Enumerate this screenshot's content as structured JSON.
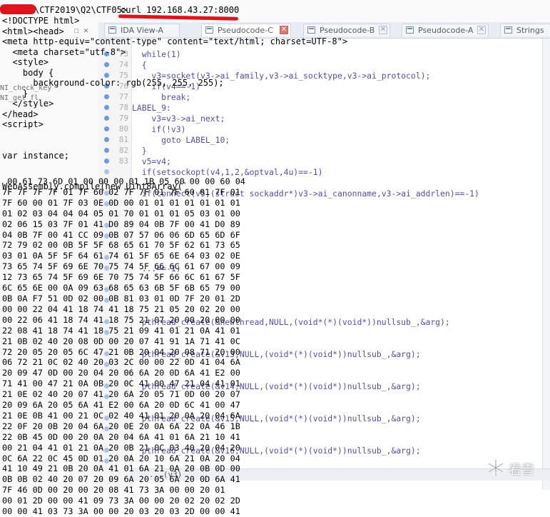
{
  "terminal": {
    "prompt": "\\CTF2019\\Q2\\CTF05>",
    "command": "curl 192.168.43.27:8000",
    "html_lines": [
      "<!DOCTYPE html>",
      "<html><head>",
      "<meta http-equiv=\"content-type\" content=\"text/html; charset=UTF-8\">",
      "  <meta charset=\"utf-8\">",
      "  <style>",
      "    body {",
      "      background-color: rgb(255, 255, 255);",
      "    }",
      "  </style>",
      "</head>",
      "<script>",
      "",
      "",
      "var instance;",
      "",
      "",
      "WebAssembly.compile(new Uint8Array(`"
    ],
    "hex_lines": [
      " 00 61 73 6D 01 00 00 00 01 1B 05 60 00 00 60 04",
      "7F 7F 7F 7F 01 7F 60 02 7F 7F 01 7F 60 01 7F 01",
      "7F 60 00 01 7F 03 0E 0D 00 01 01 01 01 01 01 01",
      "01 02 03 04 04 04 05 01 70 01 01 01 05 03 01 00",
      "02 06 15 03 7F 01 41 D0 89 04 0B 7F 00 41 D0 89",
      "04 0B 7F 00 41 CC 09 0B 07 57 06 06 6D 65 6D 6F",
      "72 79 02 00 0B 5F 5F 68 65 61 70 5F 62 61 73 65",
      "03 01 0A 5F 5F 64 61 74 61 5F 65 6E 64 03 02 0E",
      "73 65 74 5F 69 6E 70 75 74 5F 66 6C 61 67 00 09",
      "12 73 65 74 5F 69 6E 70 75 74 5F 66 6C 61 67 5F",
      "6C 65 6E 00 0A 09 63 68 65 63 6B 5F 6B 65 79 00",
      "0B 0A F7 51 0D 02 00 0B 81 03 01 0D 7F 20 01 2D",
      "00 00 22 04 41 18 74 41 18 75 21 05 20 02 20 00",
      "00 22 06 41 18 74 41 18 75 21 07 20 00 20 00 00",
      "22 08 41 18 74 41 18 75 21 09 41 01 21 0A 41 01",
      "21 0B 02 40 20 08 0D 00 20 07 41 91 1A 71 41 0C",
      "72 20 05 20 05 6C 47 21 0B 20 04 20 08 71 20 00",
      "06 72 21 0C 02 40 20 03 2C 00 00 22 0D 41 04 6A",
      "20 09 47 0D 00 20 04 20 06 6A 20 0D 6A 41 E2 00",
      "71 41 00 47 21 0A 0B 20 0C 41 00 47 21 04 41 01",
      "21 0E 02 40 20 07 41 20 6A 20 05 71 0D 00 20 07",
      "20 09 6A 20 05 6A 41 E2 00 6A 20 0D 6C 41 00 47",
      "21 0E 0B 41 00 21 0C 02 40 41 01 20 0A 20 04 6A",
      "22 0F 20 0B 20 04 6A 20 0E 20 0A 6A 22 0A 46 1B",
      "22 0B 45 0D 00 20 0A 20 04 6A 41 01 6A 21 10 41",
      "00 21 04 41 01 21 0A 20 0B 21 0C 03 40 20 04 20",
      "0C 6A 22 0C 45 0D 01 20 0A 20 10 6A 21 0A 20 04",
      "41 10 49 21 0B 20 0A 41 01 6A 21 0A 20 0B 0D 00",
      "0B 0B 02 40 20 07 20 09 6A 20 05 6A 20 0D 6A 41",
      "7F 46 0D 00 20 00 20 08 41 73 3A 00 00 20 01",
      "00 01 2D 00 00 41 09 73 3A 00 00 20 02 20 02 2D",
      "00 00 41 03 73 3A 00 00 20 03 20 03 2D 00 00 41"
    ]
  },
  "ida": {
    "tabs": [
      {
        "label": "IDA View-A",
        "active": false
      },
      {
        "label": "Pseudocode-C",
        "active": true
      },
      {
        "label": "Pseudocode-B",
        "active": false
      },
      {
        "label": "Pseudocode-A",
        "active": false
      },
      {
        "label": "Strings",
        "active": false
      }
    ],
    "pane_controls": "☐ ✕",
    "side_labels": [
      "NI_check_key",
      "NI_get_fl"
    ],
    "line_numbers": [
      "73",
      "74",
      "75",
      "76",
      "77",
      "78",
      "79",
      "80",
      "81",
      "82",
      "83"
    ],
    "code_lines": [
      "  while(1)",
      "  {",
      "    v3=socket(v3->ai_family,v3->ai_socktype,v3->ai_protocol);",
      "    if(v4==-1)",
      "      break;",
      "LABEL_9:",
      "    v3=v3->ai_next;",
      "    if(!v3)",
      "      goto LABEL_10;",
      "  }",
      "  v5=v4;",
      "  if(setsockopt(v4,1,2,&optval,4u)==-1)",
      "",
      "  if(connect(v5,(struct sockaddr*)v3->ai_canonname,v3->ai_addrlen)==-1)",
      "",
      "",
      "",
      "",
      "",
      "",
      "  ...==-1)",
      "",
      "",
      "",
      "",
      "  pthread_create(&newthread,NULL,(void*(*)(void*))nullsub_,&arg);",
      "",
      "",
      "  pthread_create(&v13,NULL,(void*(*)(void*))nullsub_,&arg);",
      "",
      "",
      "  pthread_create(&v14,NULL,(void*(*)(void*))nullsub_,&arg);",
      "",
      "",
      "  pthread_create(&v15,NULL,(void*(*)(void*))nullsub_,&arg);",
      "",
      "",
      "  pthread_create(&v16,NULL,(void*(*)(void*))nullsub_,&arg);"
    ],
    "status": "...(v3)"
  },
  "watermark": {
    "text": "看雪",
    "icon": "snowflake-icon"
  },
  "colors": {
    "annotation_red": "#e0131d",
    "ida_blue": "#2f6dd1"
  }
}
